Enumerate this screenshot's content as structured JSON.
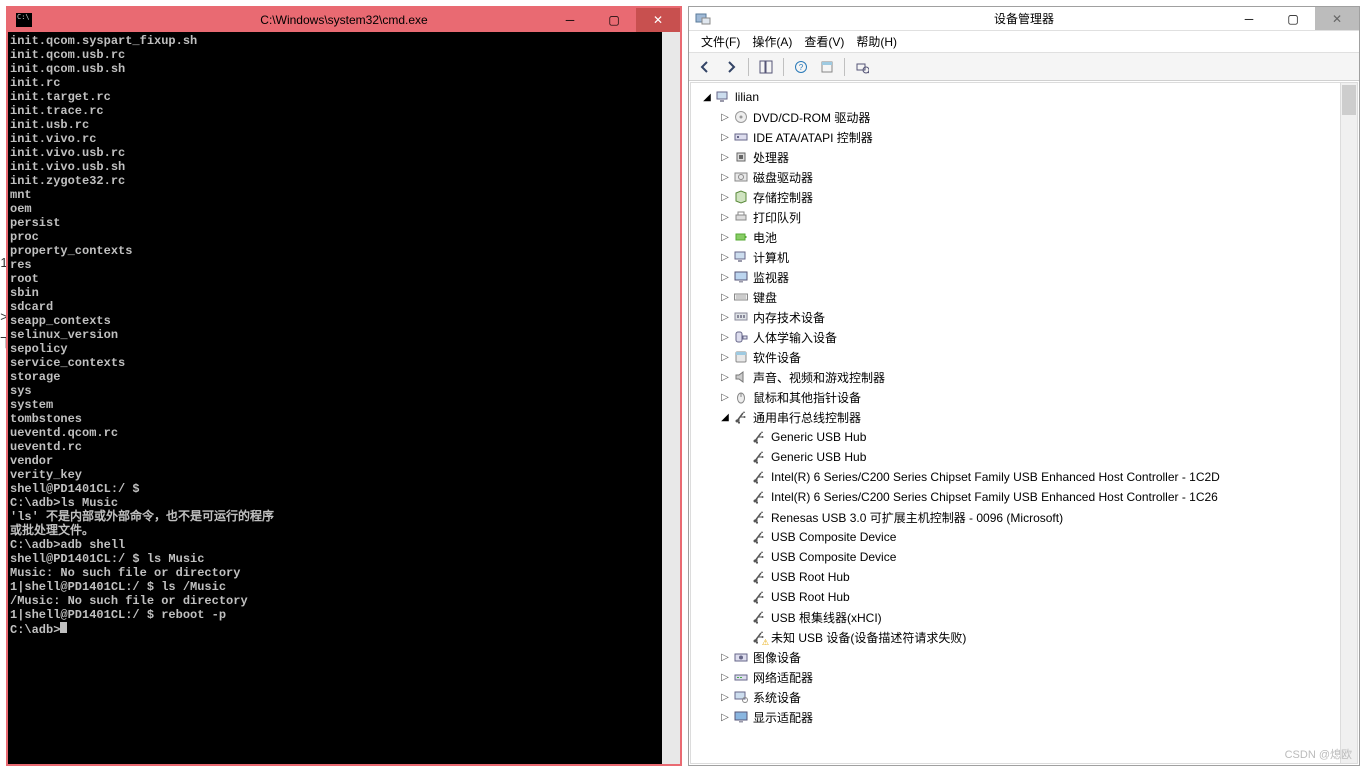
{
  "cmd": {
    "title": "C:\\Windows\\system32\\cmd.exe",
    "lines": [
      "init.qcom.syspart_fixup.sh",
      "init.qcom.usb.rc",
      "init.qcom.usb.sh",
      "init.rc",
      "init.target.rc",
      "init.trace.rc",
      "init.usb.rc",
      "init.vivo.rc",
      "init.vivo.usb.rc",
      "init.vivo.usb.sh",
      "init.zygote32.rc",
      "mnt",
      "oem",
      "persist",
      "proc",
      "property_contexts",
      "res",
      "root",
      "sbin",
      "sdcard",
      "seapp_contexts",
      "selinux_version",
      "sepolicy",
      "service_contexts",
      "storage",
      "sys",
      "system",
      "tombstones",
      "ueventd.qcom.rc",
      "ueventd.rc",
      "vendor",
      "verity_key",
      "shell@PD1401CL:/ $",
      "C:\\adb>ls Music",
      "'ls' 不是内部或外部命令，也不是可运行的程序",
      "或批处理文件。",
      "",
      "C:\\adb>adb shell",
      "shell@PD1401CL:/ $ ls Music",
      "Music: No such file or directory",
      "1|shell@PD1401CL:/ $ ls /Music",
      "/Music: No such file or directory",
      "1|shell@PD1401CL:/ $ reboot -p",
      "",
      "C:\\adb>"
    ]
  },
  "dm": {
    "title": "设备管理器",
    "menu": {
      "file": "文件(F)",
      "action": "操作(A)",
      "view": "查看(V)",
      "help": "帮助(H)"
    },
    "root": "lilian",
    "categories": [
      {
        "icon": "disc",
        "label": "DVD/CD-ROM 驱动器",
        "expandable": true
      },
      {
        "icon": "ide",
        "label": "IDE ATA/ATAPI 控制器",
        "expandable": true
      },
      {
        "icon": "cpu",
        "label": "处理器",
        "expandable": true
      },
      {
        "icon": "hdd",
        "label": "磁盘驱动器",
        "expandable": true
      },
      {
        "icon": "storage",
        "label": "存储控制器",
        "expandable": true
      },
      {
        "icon": "printer",
        "label": "打印队列",
        "expandable": true
      },
      {
        "icon": "battery",
        "label": "电池",
        "expandable": true
      },
      {
        "icon": "computer",
        "label": "计算机",
        "expandable": true
      },
      {
        "icon": "monitor",
        "label": "监视器",
        "expandable": true
      },
      {
        "icon": "keyboard",
        "label": "键盘",
        "expandable": true
      },
      {
        "icon": "memory",
        "label": "内存技术设备",
        "expandable": true
      },
      {
        "icon": "hid",
        "label": "人体学输入设备",
        "expandable": true
      },
      {
        "icon": "software",
        "label": "软件设备",
        "expandable": true
      },
      {
        "icon": "sound",
        "label": "声音、视频和游戏控制器",
        "expandable": true
      },
      {
        "icon": "mouse",
        "label": "鼠标和其他指针设备",
        "expandable": true
      },
      {
        "icon": "usb",
        "label": "通用串行总线控制器",
        "expandable": true,
        "expanded": true,
        "children": [
          {
            "icon": "usb",
            "label": "Generic USB Hub"
          },
          {
            "icon": "usb",
            "label": "Generic USB Hub"
          },
          {
            "icon": "usb",
            "label": "Intel(R) 6 Series/C200 Series Chipset Family USB Enhanced Host Controller - 1C2D"
          },
          {
            "icon": "usb",
            "label": "Intel(R) 6 Series/C200 Series Chipset Family USB Enhanced Host Controller - 1C26"
          },
          {
            "icon": "usb",
            "label": "Renesas USB 3.0 可扩展主机控制器 - 0096 (Microsoft)"
          },
          {
            "icon": "usb",
            "label": "USB Composite Device"
          },
          {
            "icon": "usb",
            "label": "USB Composite Device"
          },
          {
            "icon": "usb",
            "label": "USB Root Hub"
          },
          {
            "icon": "usb",
            "label": "USB Root Hub"
          },
          {
            "icon": "usb",
            "label": "USB 根集线器(xHCI)"
          },
          {
            "icon": "usb",
            "label": "未知 USB 设备(设备描述符请求失败)",
            "warn": true
          }
        ]
      },
      {
        "icon": "imaging",
        "label": "图像设备",
        "expandable": true
      },
      {
        "icon": "network",
        "label": "网络适配器",
        "expandable": true
      },
      {
        "icon": "system",
        "label": "系统设备",
        "expandable": true
      },
      {
        "icon": "display",
        "label": "显示适配器",
        "expandable": true
      }
    ]
  },
  "gutter": {
    "a": "1",
    "b": ">",
    "c": "下"
  },
  "watermark": "CSDN @熄欧"
}
